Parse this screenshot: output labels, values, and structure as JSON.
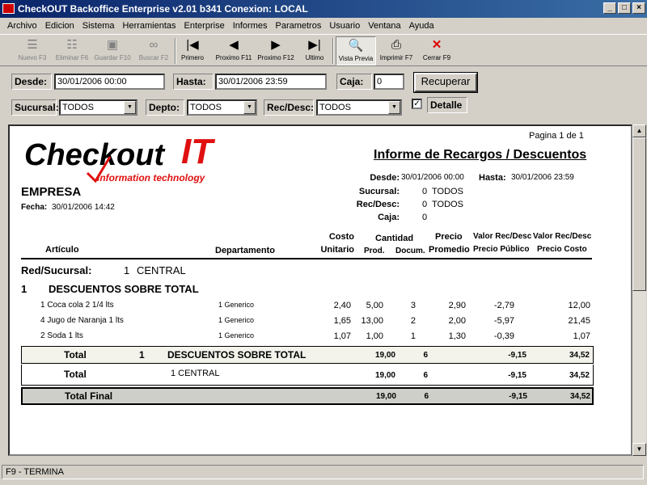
{
  "window": {
    "title": "CheckOUT Backoffice Enterprise v2.01 b341 Conexion: LOCAL"
  },
  "menu": [
    "Archivo",
    "Edicion",
    "Sistema",
    "Herramientas",
    "Enterprise",
    "Informes",
    "Parametros",
    "Usuario",
    "Ventana",
    "Ayuda"
  ],
  "toolbar": {
    "nuevo": "Nuevo F3",
    "eliminar": "Eliminar F6",
    "guardar": "Guardar F10",
    "buscar": "Buscar F2",
    "primero": "Primero",
    "proximo11": "Proximo F11",
    "proximo12": "Proximo F12",
    "ultimo": "Ultimo",
    "vista": "Vista Previa",
    "imprimir": "Imprimir F7",
    "cerrar": "Cerrar F9"
  },
  "filters": {
    "desde_label": "Desde:",
    "desde_value": "30/01/2006 00:00",
    "hasta_label": "Hasta:",
    "hasta_value": "30/01/2006 23:59",
    "caja_label": "Caja:",
    "caja_value": "0",
    "recuperar": "Recuperar",
    "sucursal_label": "Sucursal:",
    "sucursal_value": "TODOS",
    "depto_label": "Depto:",
    "depto_value": "TODOS",
    "recdesc_label": "Rec/Desc:",
    "recdesc_value": "TODOS",
    "detalle_label": "Detalle",
    "detalle_checked": true
  },
  "report": {
    "logo_main": "Checkout",
    "logo_it": "IT",
    "logo_tag": "information technology",
    "page": "Pagina 1 de 1",
    "title": "Informe de Recargos / Descuentos",
    "empresa": "EMPRESA",
    "fecha_label": "Fecha:",
    "fecha_value": "30/01/2006 14:42",
    "h_desde_label": "Desde:",
    "h_desde": "30/01/2006 00:00",
    "h_hasta_label": "Hasta:",
    "h_hasta": "30/01/2006 23:59",
    "h_sucursal_label": "Sucursal:",
    "h_sucursal_num": "0",
    "h_sucursal_val": "TODOS",
    "h_recdesc_label": "Rec/Desc:",
    "h_recdesc_num": "0",
    "h_recdesc_val": "TODOS",
    "h_caja_label": "Caja:",
    "h_caja": "0",
    "col": {
      "articulo": "Artículo",
      "depto": "Departamento",
      "costo1": "Costo",
      "costo2": "Unitario",
      "cantidad": "Cantidad",
      "prod": "Prod.",
      "docum": "Docum.",
      "precio1": "Precio",
      "precio2": "Promedio",
      "vrd1": "Valor Rec/Desc",
      "vrd2": "Precio Público",
      "vrd3": "Valor Rec/Desc",
      "vrd4": "Precio Costo"
    },
    "group_label": "Red/Sucursal:",
    "group_num": "1",
    "group_name": "CENTRAL",
    "sub_num": "1",
    "sub_name": "DESCUENTOS SOBRE TOTAL",
    "rows": [
      {
        "art": "1 Coca cola 2 1/4 lts",
        "dep": "1 Generico",
        "costo": "2,40",
        "prod": "5,00",
        "doc": "3",
        "precio": "2,90",
        "vpp": "-2,79",
        "vpc": "12,00"
      },
      {
        "art": "4 Jugo de Naranja 1 lts",
        "dep": "1 Generico",
        "costo": "1,65",
        "prod": "13,00",
        "doc": "2",
        "precio": "2,00",
        "vpp": "-5,97",
        "vpc": "21,45"
      },
      {
        "art": "2 Soda 1 lts",
        "dep": "1 Generico",
        "costo": "1,07",
        "prod": "1,00",
        "doc": "1",
        "precio": "1,30",
        "vpp": "-0,39",
        "vpc": "1,07"
      }
    ],
    "tot1": {
      "label": "Total",
      "num": "1",
      "name": "DESCUENTOS SOBRE TOTAL",
      "prod": "19,00",
      "doc": "6",
      "vpp": "-9,15",
      "vpc": "34,52"
    },
    "tot2": {
      "label": "Total",
      "name": "1 CENTRAL",
      "prod": "19,00",
      "doc": "6",
      "vpp": "-9,15",
      "vpc": "34,52"
    },
    "tot3": {
      "label": "Total Final",
      "prod": "19,00",
      "doc": "6",
      "vpp": "-9,15",
      "vpc": "34,52"
    }
  },
  "status": {
    "text": "F9 - TERMINA"
  }
}
